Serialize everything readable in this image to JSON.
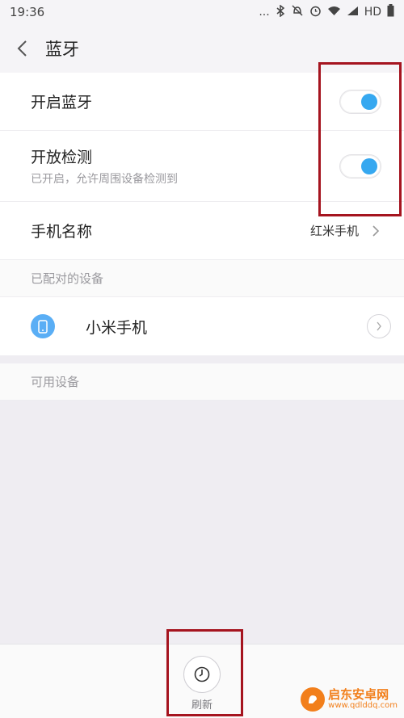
{
  "status_bar": {
    "time": "19:36",
    "dots": "...",
    "network": "HD"
  },
  "header": {
    "title": "蓝牙"
  },
  "settings": {
    "bluetooth": {
      "label": "开启蓝牙",
      "enabled": true
    },
    "discoverable": {
      "label": "开放检测",
      "sub": "已开启，允许周围设备检测到",
      "enabled": true
    },
    "device_name": {
      "label": "手机名称",
      "value": "红米手机"
    }
  },
  "paired": {
    "header": "已配对的设备",
    "devices": [
      {
        "name": "小米手机"
      }
    ]
  },
  "available": {
    "header": "可用设备"
  },
  "bottom": {
    "refresh_label": "刷新"
  },
  "watermark": {
    "title": "启东安卓网",
    "url": "www.qdlddq.com"
  },
  "colors": {
    "accent": "#36a8f0",
    "highlight": "#a5141f"
  }
}
